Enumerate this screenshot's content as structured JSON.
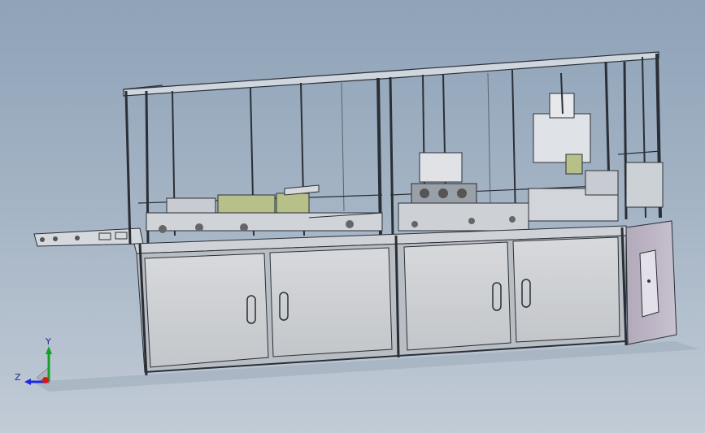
{
  "viewport": {
    "background_top": "#8fa2b8",
    "background_bottom": "#c2cbd6",
    "frame_color": "#cfd6de",
    "frame_edge": "#2a2f36",
    "panel_color": "#cfd1d4",
    "side_panel_color": "#b9b2c0",
    "mechanism_color": "#b8c08a"
  },
  "model": {
    "subject": "automated-assembly-machine",
    "cabinet_doors": 4,
    "door_handles": 4
  },
  "triad": {
    "y_label": "Y",
    "z_label": "Z",
    "y_color": "#16a02a",
    "z_color": "#1b2ae0",
    "x_color": "#d81818"
  }
}
